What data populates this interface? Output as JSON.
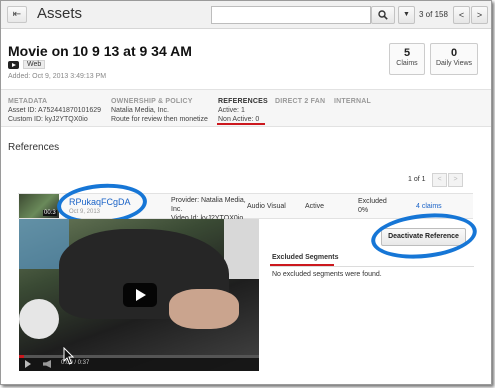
{
  "topbar": {
    "back_icon": "arrow-left-icon",
    "title": "Assets",
    "search": {
      "value": "",
      "placeholder": ""
    },
    "search_icon": "magnifier",
    "dropdown_icon": "caret-down",
    "pager_text": "3 of 158",
    "prev_label": "<",
    "next_label": ">"
  },
  "asset": {
    "title": "Movie on 10 9 13 at 9 34 AM",
    "platform": "Web",
    "added": "Added: Oct 9, 2013 3:49:13 PM",
    "stats": [
      {
        "value": "5",
        "label": "Claims"
      },
      {
        "value": "0",
        "label": "Daily Views"
      }
    ]
  },
  "tabs": {
    "metadata": {
      "label": "METADATA",
      "line1": "Asset ID: A752441870101629",
      "line2": "Custom ID: kyJ2YTQX0io"
    },
    "ownership": {
      "label": "OWNERSHIP & POLICY",
      "line1": "Natalia Media, Inc.",
      "line2": "Route for review then monetize"
    },
    "references": {
      "label": "REFERENCES",
      "line1": "Active: 1",
      "line2": "Non Active: 0"
    },
    "direct2fan": {
      "label": "DIRECT 2 FAN"
    },
    "internal": {
      "label": "INTERNAL"
    }
  },
  "references": {
    "section_title": "References",
    "pager_text": "1 of 1",
    "prev_label": "<",
    "next_label": ">",
    "row": {
      "thumb_time": "00:3",
      "ref_id": "RPukaqFCgDA",
      "ref_date": "Oct 9, 2013",
      "provider_line1": "Provider: Natalia Media,",
      "provider_line2": "Inc.",
      "video_id": "Video Id: kyJ2YTQX0io",
      "type": "Audio Visual",
      "status": "Active",
      "excluded_label": "Excluded",
      "excluded_value": "0%",
      "claims_link": "4 claims"
    },
    "deactivate_label": "Deactivate Reference",
    "excluded_segments_title": "Excluded Segments",
    "excluded_empty": "No excluded segments were found."
  },
  "player": {
    "time": "0:00 / 0:37",
    "progress": 0.02,
    "play_icon": "play-icon"
  },
  "colors": {
    "accent_red": "#cc181e",
    "link_blue": "#1a63c7",
    "annotation_blue": "#1676d6"
  }
}
